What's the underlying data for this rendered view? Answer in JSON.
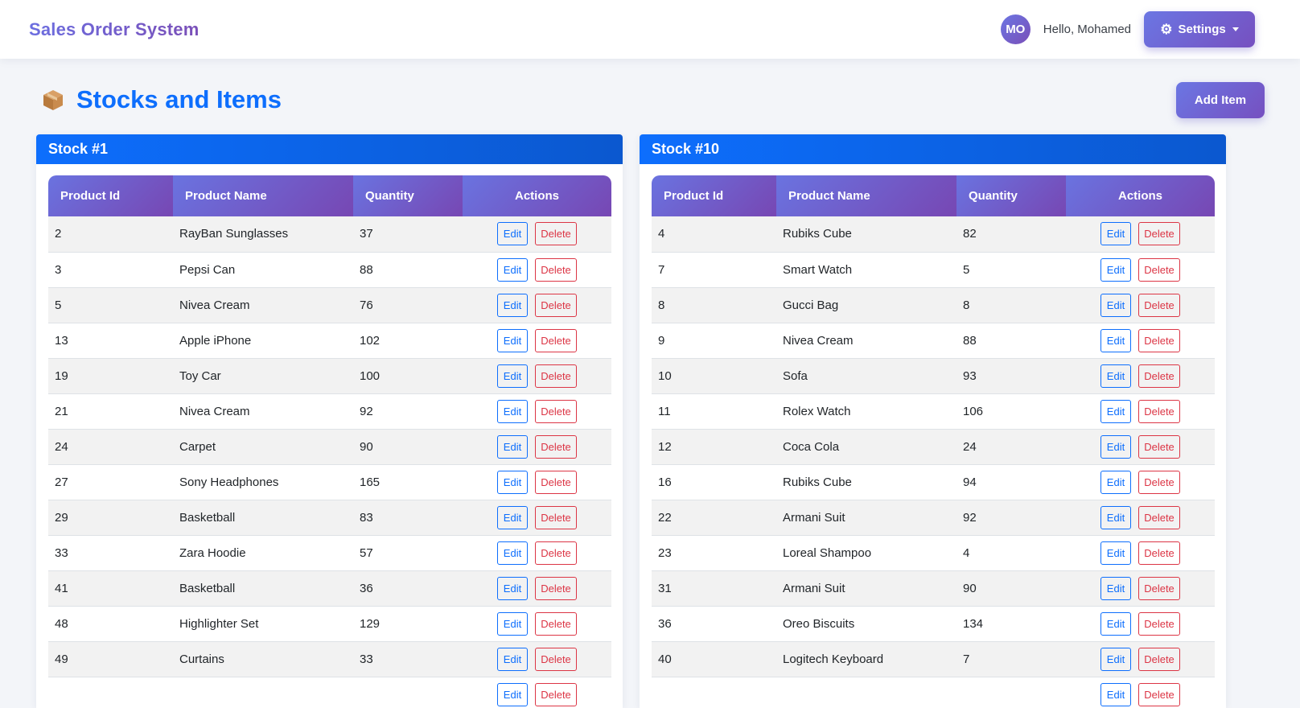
{
  "app": {
    "title": "Sales Order System",
    "user_initials": "MO",
    "greeting": "Hello, Mohamed",
    "settings_label": "Settings"
  },
  "page": {
    "title": "Stocks and Items",
    "add_item_label": "Add Item",
    "icon": "package-box-icon"
  },
  "table_headers": {
    "product_id": "Product Id",
    "product_name": "Product Name",
    "quantity": "Quantity",
    "actions": "Actions"
  },
  "action_labels": {
    "edit": "Edit",
    "delete": "Delete"
  },
  "colors": {
    "primary": "#0d6efd",
    "accent_start": "#6b76e3",
    "accent_end": "#7650c0",
    "danger": "#dc3545"
  },
  "stocks": [
    {
      "title": "Stock #1",
      "rows": [
        {
          "id": "2",
          "name": "RayBan Sunglasses",
          "qty": "37"
        },
        {
          "id": "3",
          "name": "Pepsi Can",
          "qty": "88"
        },
        {
          "id": "5",
          "name": "Nivea Cream",
          "qty": "76"
        },
        {
          "id": "13",
          "name": "Apple iPhone",
          "qty": "102"
        },
        {
          "id": "19",
          "name": "Toy Car",
          "qty": "100"
        },
        {
          "id": "21",
          "name": "Nivea Cream",
          "qty": "92"
        },
        {
          "id": "24",
          "name": "Carpet",
          "qty": "90"
        },
        {
          "id": "27",
          "name": "Sony Headphones",
          "qty": "165"
        },
        {
          "id": "29",
          "name": "Basketball",
          "qty": "83"
        },
        {
          "id": "33",
          "name": "Zara Hoodie",
          "qty": "57"
        },
        {
          "id": "41",
          "name": "Basketball",
          "qty": "36"
        },
        {
          "id": "48",
          "name": "Highlighter Set",
          "qty": "129"
        },
        {
          "id": "49",
          "name": "Curtains",
          "qty": "33"
        },
        {
          "id": "",
          "name": "",
          "qty": ""
        }
      ]
    },
    {
      "title": "Stock #10",
      "rows": [
        {
          "id": "4",
          "name": "Rubiks Cube",
          "qty": "82"
        },
        {
          "id": "7",
          "name": "Smart Watch",
          "qty": "5"
        },
        {
          "id": "8",
          "name": "Gucci Bag",
          "qty": "8"
        },
        {
          "id": "9",
          "name": "Nivea Cream",
          "qty": "88"
        },
        {
          "id": "10",
          "name": "Sofa",
          "qty": "93"
        },
        {
          "id": "11",
          "name": "Rolex Watch",
          "qty": "106"
        },
        {
          "id": "12",
          "name": "Coca Cola",
          "qty": "24"
        },
        {
          "id": "16",
          "name": "Rubiks Cube",
          "qty": "94"
        },
        {
          "id": "22",
          "name": "Armani Suit",
          "qty": "92"
        },
        {
          "id": "23",
          "name": "Loreal Shampoo",
          "qty": "4"
        },
        {
          "id": "31",
          "name": "Armani Suit",
          "qty": "90"
        },
        {
          "id": "36",
          "name": "Oreo Biscuits",
          "qty": "134"
        },
        {
          "id": "40",
          "name": "Logitech Keyboard",
          "qty": "7"
        },
        {
          "id": "",
          "name": "",
          "qty": ""
        }
      ]
    }
  ]
}
